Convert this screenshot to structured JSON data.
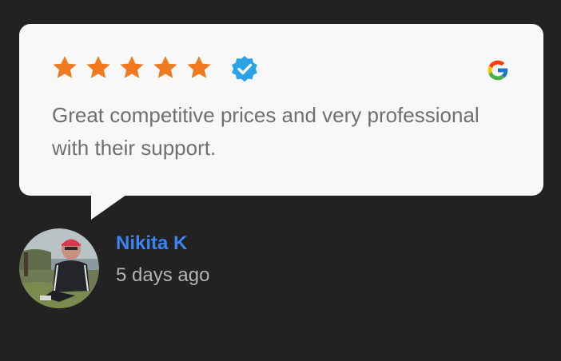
{
  "review": {
    "rating": 5,
    "rating_max": 5,
    "verified_icon": "verified-badge-icon",
    "source_icon": "google-logo-icon",
    "text": "Great competitive prices and very professional with their support."
  },
  "author": {
    "name": "Nikita K",
    "date": "5 days ago",
    "avatar_icon": "avatar-photo"
  },
  "colors": {
    "background": "#222222",
    "card": "#f8f8f8",
    "star": "#f07a1d",
    "verified": "#2aa3e6",
    "name": "#3c84f0",
    "review_text": "#6f6f6f",
    "date": "#b4b4b4"
  }
}
